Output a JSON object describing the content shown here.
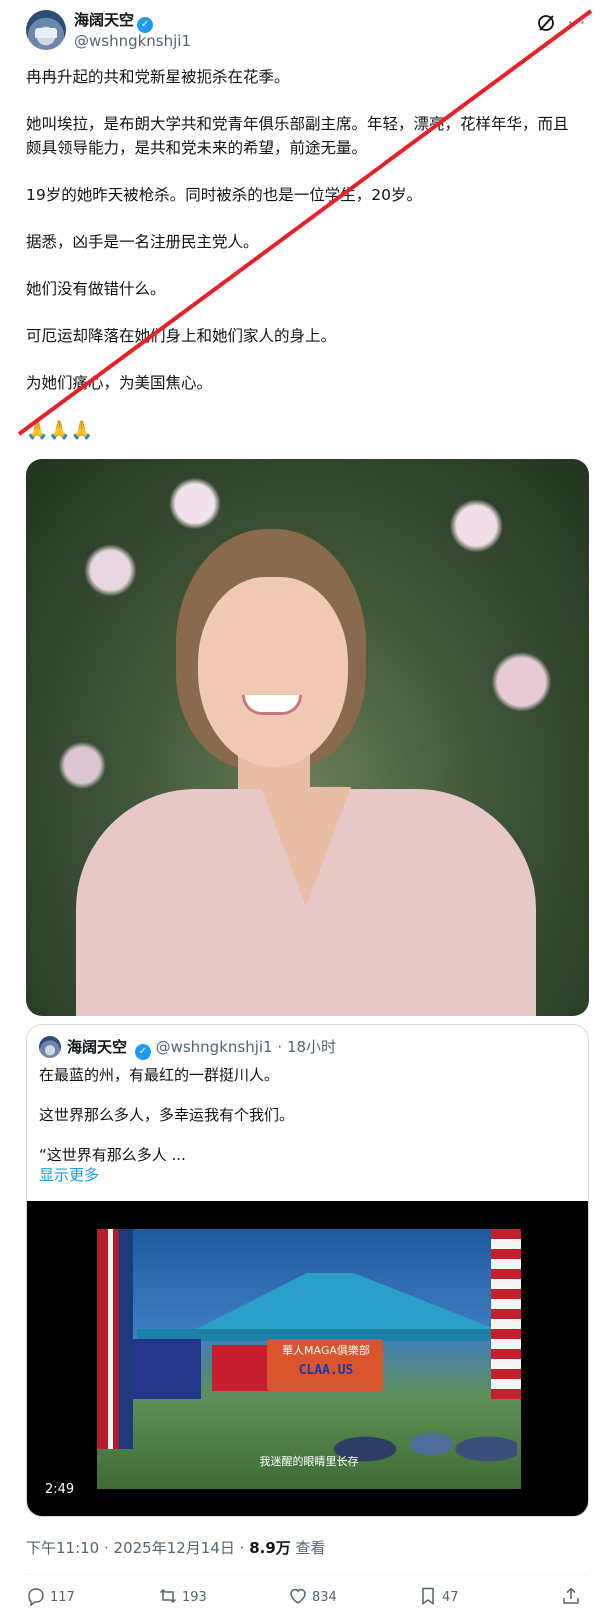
{
  "author": {
    "name": "海阔天空",
    "handle": "@wshngknshji1"
  },
  "tweet": {
    "paragraphs": [
      "冉冉升起的共和党新星被扼杀在花季。",
      "她叫埃拉，是布朗大学共和党青年俱乐部副主席。年轻，漂亮，花样年华，而且颇具领导能力，是共和党未来的希望，前途无量。",
      "19岁的她昨天被枪杀。同时被杀的也是一位学生，20岁。",
      "据悉，凶手是一名注册民主党人。",
      "她们没有做错什么。",
      "可厄运却降落在她们身上和她们家人的身上。",
      "为她们痛心，为美国焦心。"
    ],
    "emoji": "🙏🙏🙏"
  },
  "quoted": {
    "name": "海阔天空",
    "handle": "@wshngknshji1",
    "dot": "·",
    "time": "18小时",
    "lines": [
      "在最蓝的州，有最红的一群挺川人。",
      "这世界那么多人，多幸运我有个我们。",
      "“这世界有那么多人 ..."
    ],
    "show_more": "显示更多",
    "video": {
      "banner_line": "華人MAGA俱樂部",
      "banner_site": "CLAA.US",
      "subtitle": "我迷醒的眼睛里长存",
      "duration": "2:49"
    }
  },
  "meta": {
    "time": "下午11:10 · 2025年12月14日 · ",
    "views": "8.9万",
    "views_label": " 查看"
  },
  "actions": {
    "replies": "117",
    "reposts": "193",
    "likes": "834",
    "bookmarks": "47"
  },
  "colors": {
    "accent": "#1d9bf0",
    "strike": "#e8202a"
  }
}
